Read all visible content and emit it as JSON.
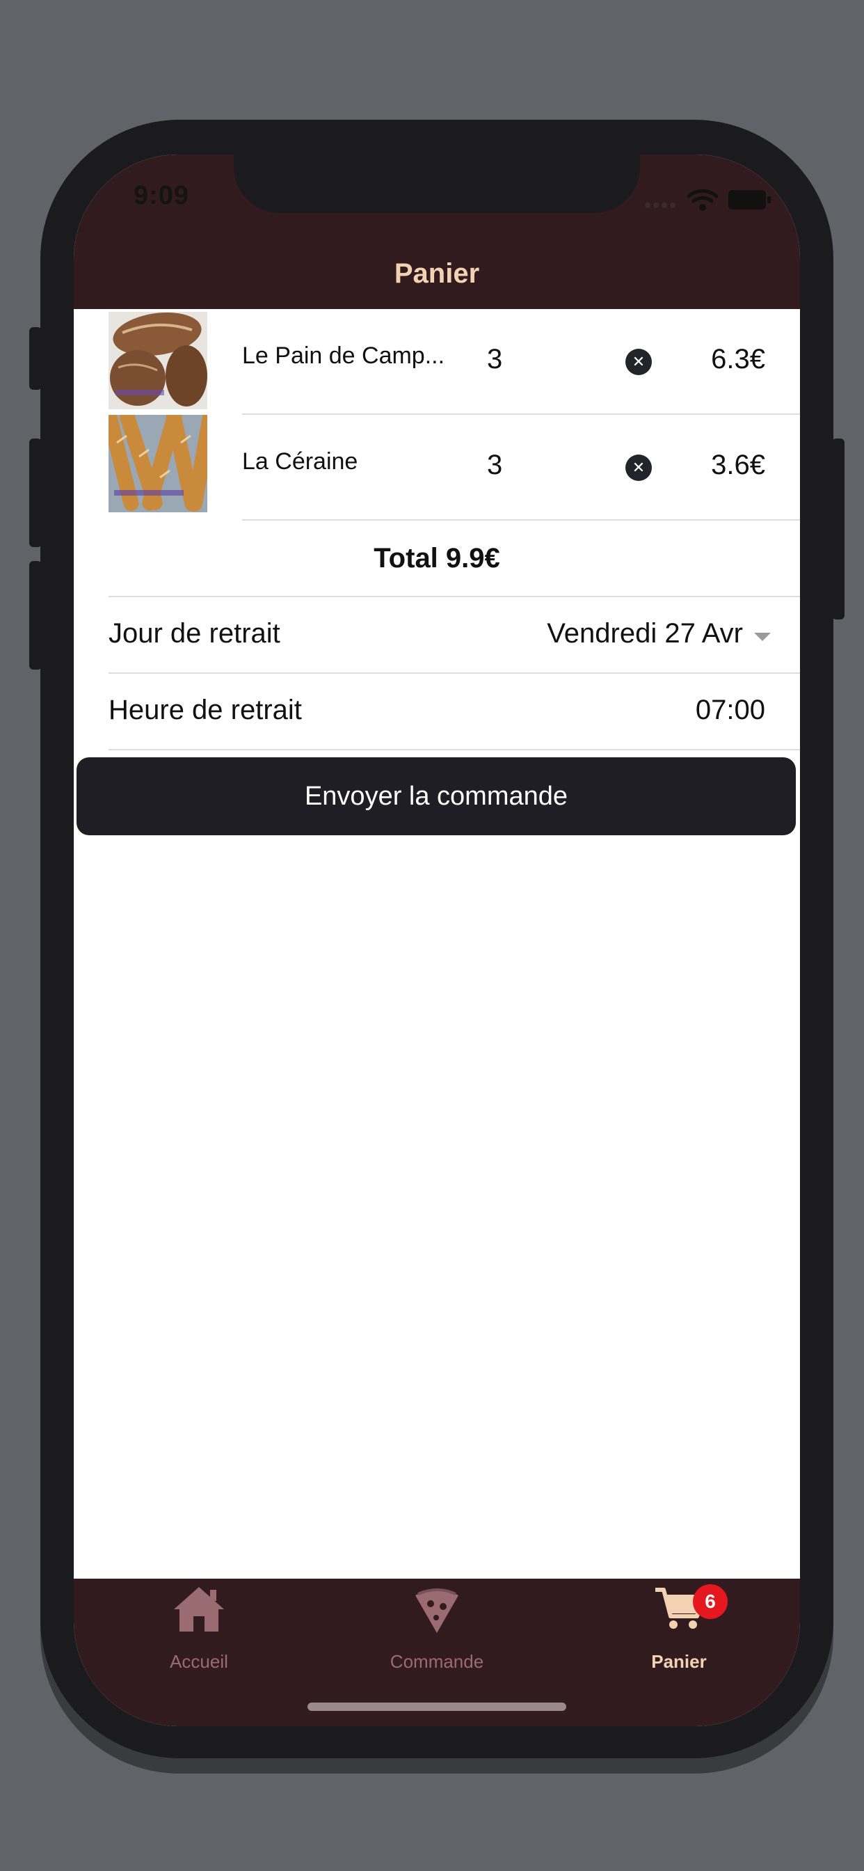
{
  "status_bar": {
    "time": "9:09"
  },
  "header": {
    "title": "Panier"
  },
  "cart": {
    "items": [
      {
        "name": "Le Pain de Camp...",
        "quantity": "3",
        "price": "6.3€",
        "remove_icon": "close-circle-icon"
      },
      {
        "name": "La Céraine",
        "quantity": "3",
        "price": "3.6€",
        "remove_icon": "close-circle-icon"
      }
    ],
    "total": "Total 9.9€"
  },
  "pickup": {
    "day_label": "Jour de retrait",
    "day_value": "Vendredi 27 Avr",
    "hour_label": "Heure de retrait",
    "hour_value": "07:00"
  },
  "submit_button": "Envoyer la commande",
  "tabs": [
    {
      "label": "Accueil",
      "icon": "home-icon",
      "active": false
    },
    {
      "label": "Commande",
      "icon": "pizza-icon",
      "active": false
    },
    {
      "label": "Panier",
      "icon": "cart-icon",
      "active": true,
      "badge": "6"
    }
  ],
  "colors": {
    "bar_background": "#311b1f",
    "title_text": "#f2d2b2",
    "active_tab": "#f2d2b2",
    "inactive_tab": "#9b6b72",
    "button_background": "#1f1e25",
    "badge": "#e5171f",
    "outer_background": "#626368"
  }
}
